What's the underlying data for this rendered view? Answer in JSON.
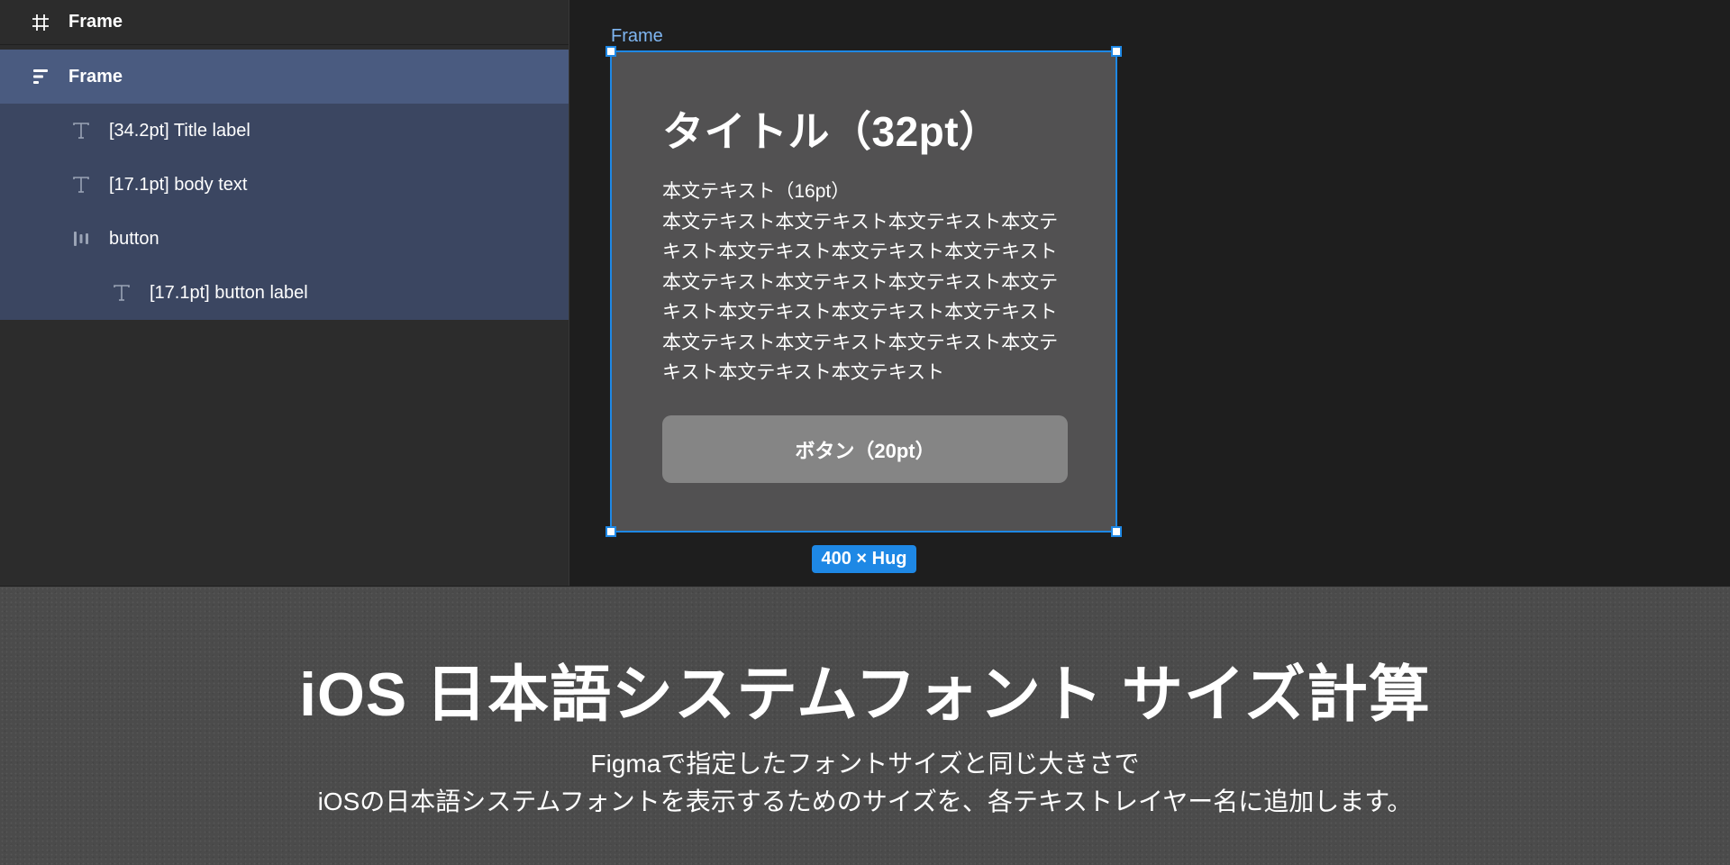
{
  "layers": {
    "items": [
      {
        "label": "Frame",
        "icon": "hash-icon"
      },
      {
        "label": "Frame",
        "icon": "auto-layout-icon",
        "selected": true
      },
      {
        "label": "[34.2pt] Title label",
        "icon": "text-icon"
      },
      {
        "label": "[17.1pt] body text",
        "icon": "text-icon"
      },
      {
        "label": "button",
        "icon": "auto-layout-horizontal-icon"
      },
      {
        "label": "[17.1pt] button label",
        "icon": "text-icon"
      }
    ]
  },
  "canvas": {
    "frame_label": "Frame",
    "title": "タイトル（32pt）",
    "body_line1": "本文テキスト（16pt）",
    "body_text": "本文テキスト本文テキスト本文テキスト本文テキスト本文テキスト本文テキスト本文テキスト本文テキスト本文テキスト本文テキスト本文テキスト本文テキスト本文テキスト本文テキスト本文テキスト本文テキスト本文テキスト本文テキスト本文テキスト本文テキスト",
    "button_label": "ボタン（20pt）",
    "size_badge": "400 × Hug",
    "selection_color": "#1e88e5"
  },
  "banner": {
    "title": "iOS 日本語システムフォント サイズ計算",
    "desc_line1": "Figmaで指定したフォントサイズと同じ大きさで",
    "desc_line2": "iOSの日本語システムフォントを表示するためのサイズを、各テキストレイヤー名に追加します。"
  }
}
